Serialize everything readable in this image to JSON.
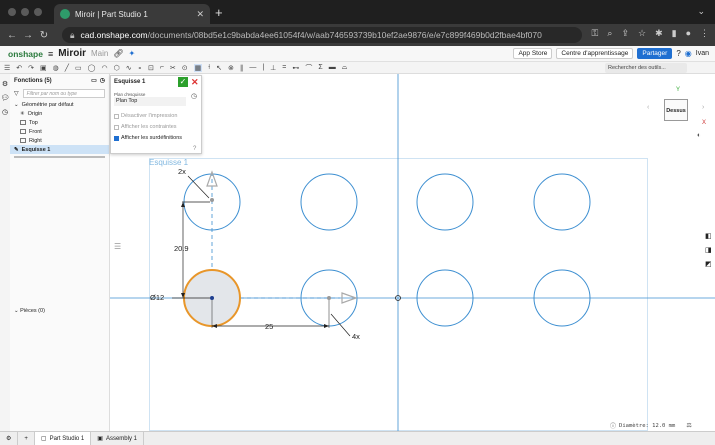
{
  "browser": {
    "tab_title": "Miroir | Part Studio 1",
    "new_tab": "+",
    "url_host": "cad.onshape.com",
    "url_path": "/documents/08bd5e1c9babda4ee61054f4/w/aab746593739b10ef2ae9876/e/e7c899f469b0d2fbae4bf070"
  },
  "onshape": {
    "logo": "onshape",
    "doc_name": "Miroir",
    "branch": "Main",
    "app_store": "App Store",
    "learning": "Centre d'apprentissage",
    "share": "Partager",
    "user": "Ivan",
    "tool_search": "Rechercher des outils..."
  },
  "features": {
    "title": "Fonctions (5)",
    "filter_placeholder": "Filtrer par nom ou type",
    "default_geometry": "Géométrie par défaut",
    "items": [
      "Origin",
      "Top",
      "Front",
      "Right"
    ],
    "active_sketch": "Esquisse 1",
    "parts": "Pièces (0)"
  },
  "sketch_dialog": {
    "title": "Esquisse 1",
    "plane_label": "Plan d'esquisse",
    "plane_value": "Plan Top",
    "opt_disable_print": "Désactiver l'impression",
    "opt_show_constraints": "Afficher les contraintes",
    "opt_show_overdef": "Afficher les surdéfinitions"
  },
  "canvas": {
    "sketch_label": "Esquisse 1",
    "dim_count_top": "2x",
    "dim_vertical": "20.9",
    "dim_diameter": "Ø12",
    "dim_horizontal": "25",
    "dim_count_right": "4x",
    "viewcube_face": "Dessus",
    "diameter_readout": "Diamètre: 12.0 mm"
  },
  "bottom_tabs": [
    "Part Studio 1",
    "Assembly 1"
  ],
  "colors": {
    "sketch_blue": "#3d8fd1",
    "selected_orange": "#e8962a",
    "accent": "#1f6fd1"
  }
}
